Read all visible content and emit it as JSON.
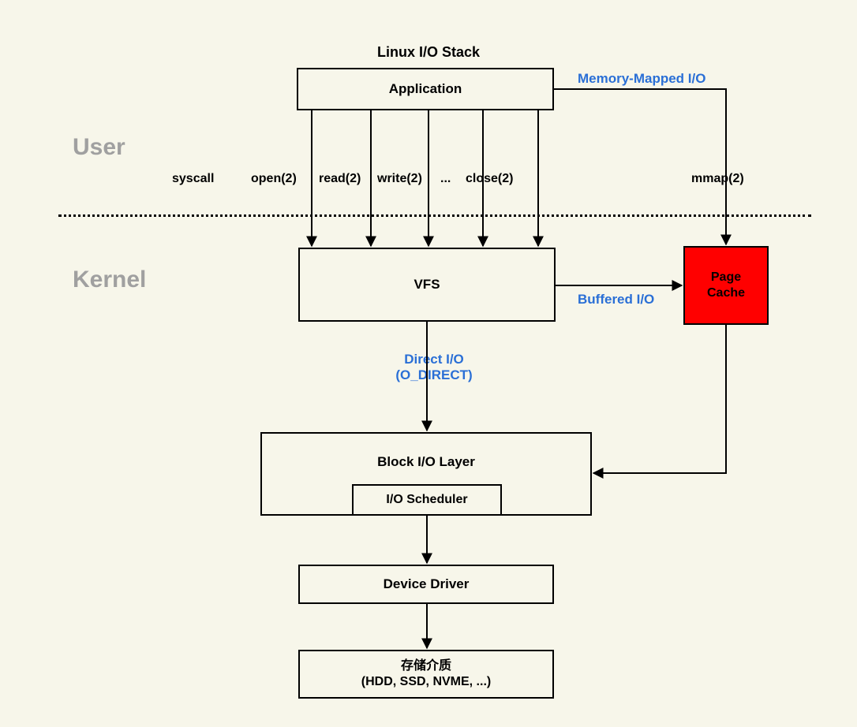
{
  "title": "Linux I/O Stack",
  "space": {
    "user": "User",
    "kernel": "Kernel"
  },
  "boxes": {
    "application": "Application",
    "vfs": "VFS",
    "pagecache": "Page\nCache",
    "blockio": "Block I/O Layer",
    "iosched": "I/O Scheduler",
    "devdrv": "Device Driver",
    "storage": "存储介质\n(HDD, SSD, NVME, ...)"
  },
  "io": {
    "mmapio": "Memory-Mapped I/O",
    "buffered": "Buffered I/O",
    "direct": "Direct I/O\n(O_DIRECT)"
  },
  "syscalls": {
    "label": "syscall",
    "open": "open(2)",
    "read": "read(2)",
    "write": "write(2)",
    "dots": "...",
    "close": "close(2)",
    "mmap": "mmap(2)"
  }
}
